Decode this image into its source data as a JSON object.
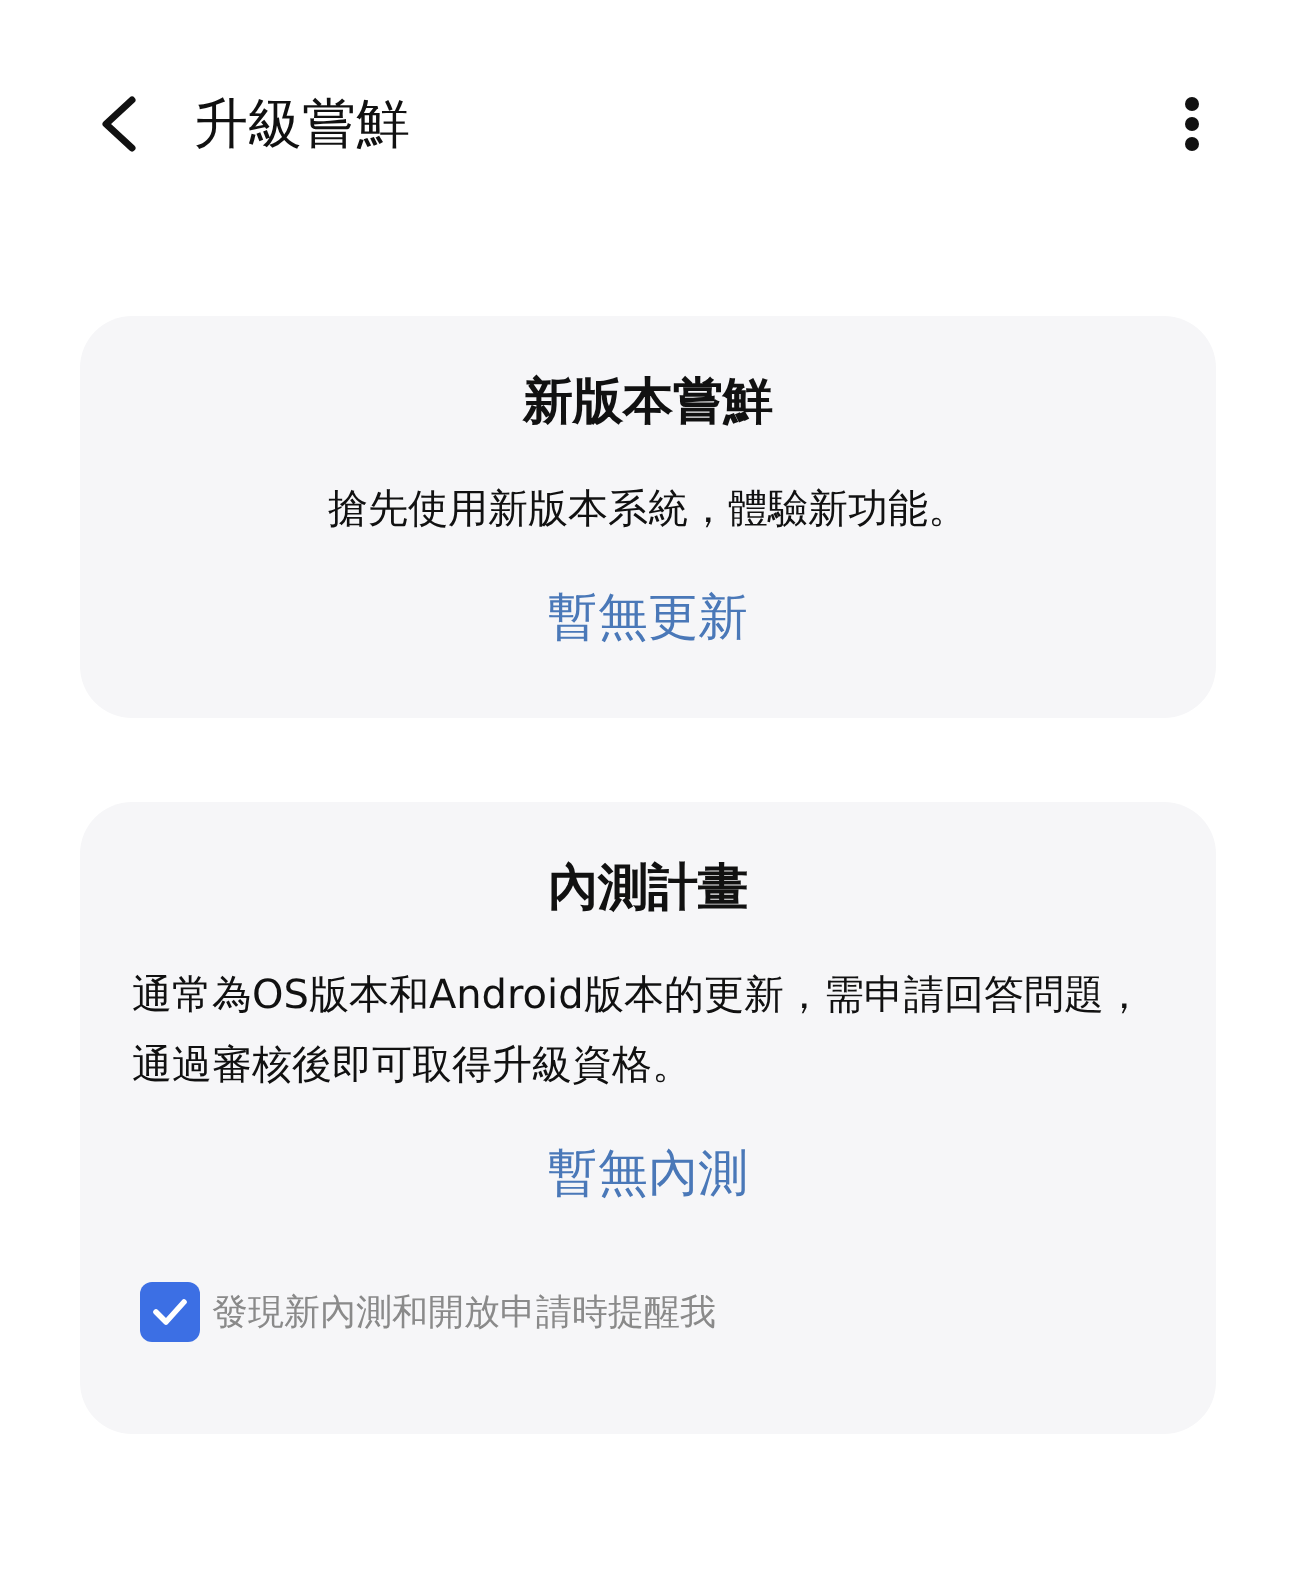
{
  "header": {
    "title": "升級嘗鮮"
  },
  "cards": [
    {
      "title": "新版本嘗鮮",
      "description": "搶先使用新版本系統，體驗新功能。",
      "kind": "feature",
      "link": "暫無更新"
    },
    {
      "title": "內測計畫",
      "description": "通常為OS版本和Android版本的更新，需申請回答問題，通過審核後即可取得升級資格。",
      "kind": "program",
      "link": "暫無內測",
      "checkbox": {
        "label": "發現新內測和開放申請時提醒我",
        "checked": true
      }
    }
  ]
}
